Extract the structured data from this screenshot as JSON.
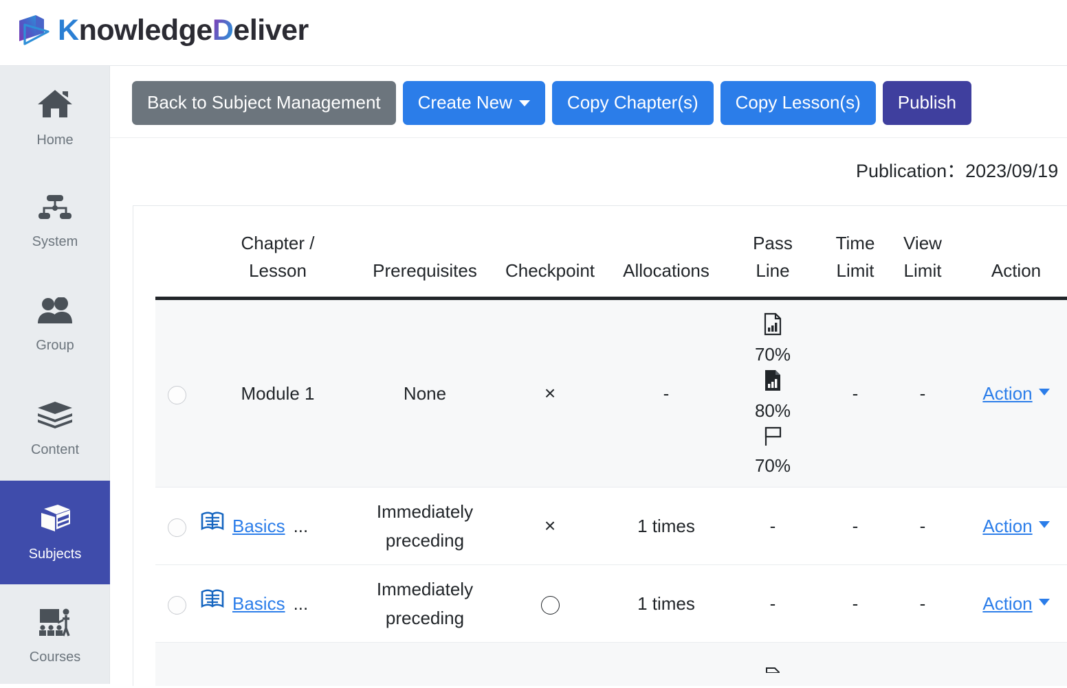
{
  "brand": {
    "logo_icon": "book-play-logo-icon",
    "name_part1": "K",
    "name_part2": "nowledge",
    "name_part3": "D",
    "name_part4": "eliver",
    "accent_blue": "#2a7fd4",
    "accent_purple": "#7d3fb5",
    "dark": "#2b2b33"
  },
  "sidebar": {
    "items": [
      {
        "label": "Home",
        "icon": "home-icon",
        "active": false
      },
      {
        "label": "System",
        "icon": "sitemap-icon",
        "active": false
      },
      {
        "label": "Group",
        "icon": "users-icon",
        "active": false
      },
      {
        "label": "Content",
        "icon": "layers-icon",
        "active": false
      },
      {
        "label": "Subjects",
        "icon": "books-icon",
        "active": true
      },
      {
        "label": "Courses",
        "icon": "classroom-icon",
        "active": false
      }
    ],
    "active_bg": "#3f4cab"
  },
  "toolbar": {
    "buttons": [
      {
        "label": "Back to Subject Management",
        "style": "grey",
        "caret": false
      },
      {
        "label": "Create New",
        "style": "blue",
        "caret": true
      },
      {
        "label": "Copy Chapter(s)",
        "style": "blue",
        "caret": false
      },
      {
        "label": "Copy Lesson(s)",
        "style": "blue",
        "caret": false
      },
      {
        "label": "Publish",
        "style": "indigo",
        "caret": false
      }
    ],
    "colors": {
      "grey": "#6c757d",
      "blue": "#2b7de9",
      "indigo": "#3f3f9e"
    }
  },
  "publication": {
    "text": "Publication：2023/09/19"
  },
  "table": {
    "headers": {
      "select": "",
      "chapter_lesson_line1": "Chapter /",
      "chapter_lesson_line2": "Lesson",
      "prerequisites": "Prerequisites",
      "checkpoint": "Checkpoint",
      "allocations": "Allocations",
      "pass_line1": "Pass",
      "pass_line2": "Line",
      "time_line1": "Time",
      "time_line2": "Limit",
      "view_line1": "View",
      "view_line2": "Limit",
      "action": "Action"
    },
    "rows": [
      {
        "type": "chapter",
        "selector": "radio-unselected",
        "title": "Module 1",
        "title_is_link": false,
        "icon": "",
        "ellipsis": "",
        "prerequisites": "None",
        "checkpoint_glyph": "×",
        "allocations": "-",
        "pass_line": [
          {
            "icon": "file-chart-outline-icon",
            "value": "70%"
          },
          {
            "icon": "file-chart-filled-icon",
            "value": "80%"
          },
          {
            "icon": "flag-outline-icon",
            "value": "70%"
          }
        ],
        "time_limit": "-",
        "view_limit": "-",
        "action_label": "Action",
        "shaded": true
      },
      {
        "type": "lesson",
        "selector": "radio-unselected",
        "title": "Basics ",
        "title_is_link": true,
        "icon": "open-book-icon",
        "ellipsis": "...",
        "prerequisites_line1": "Immediately",
        "prerequisites_line2": "preceding",
        "checkpoint_glyph": "×",
        "allocations": "1 times",
        "pass_line_plain": "-",
        "time_limit": "-",
        "view_limit": "-",
        "action_label": "Action",
        "shaded": false
      },
      {
        "type": "lesson",
        "selector": "radio-unselected",
        "title": "Basics ",
        "title_is_link": true,
        "icon": "open-book-icon",
        "ellipsis": "...",
        "prerequisites_line1": "Immediately",
        "prerequisites_line2": "preceding",
        "checkpoint_glyph": "circle",
        "allocations": "1 times",
        "pass_line_plain": "-",
        "time_limit": "-",
        "view_limit": "-",
        "action_label": "Action",
        "shaded": false
      }
    ]
  },
  "link_color": "#2b7de9"
}
